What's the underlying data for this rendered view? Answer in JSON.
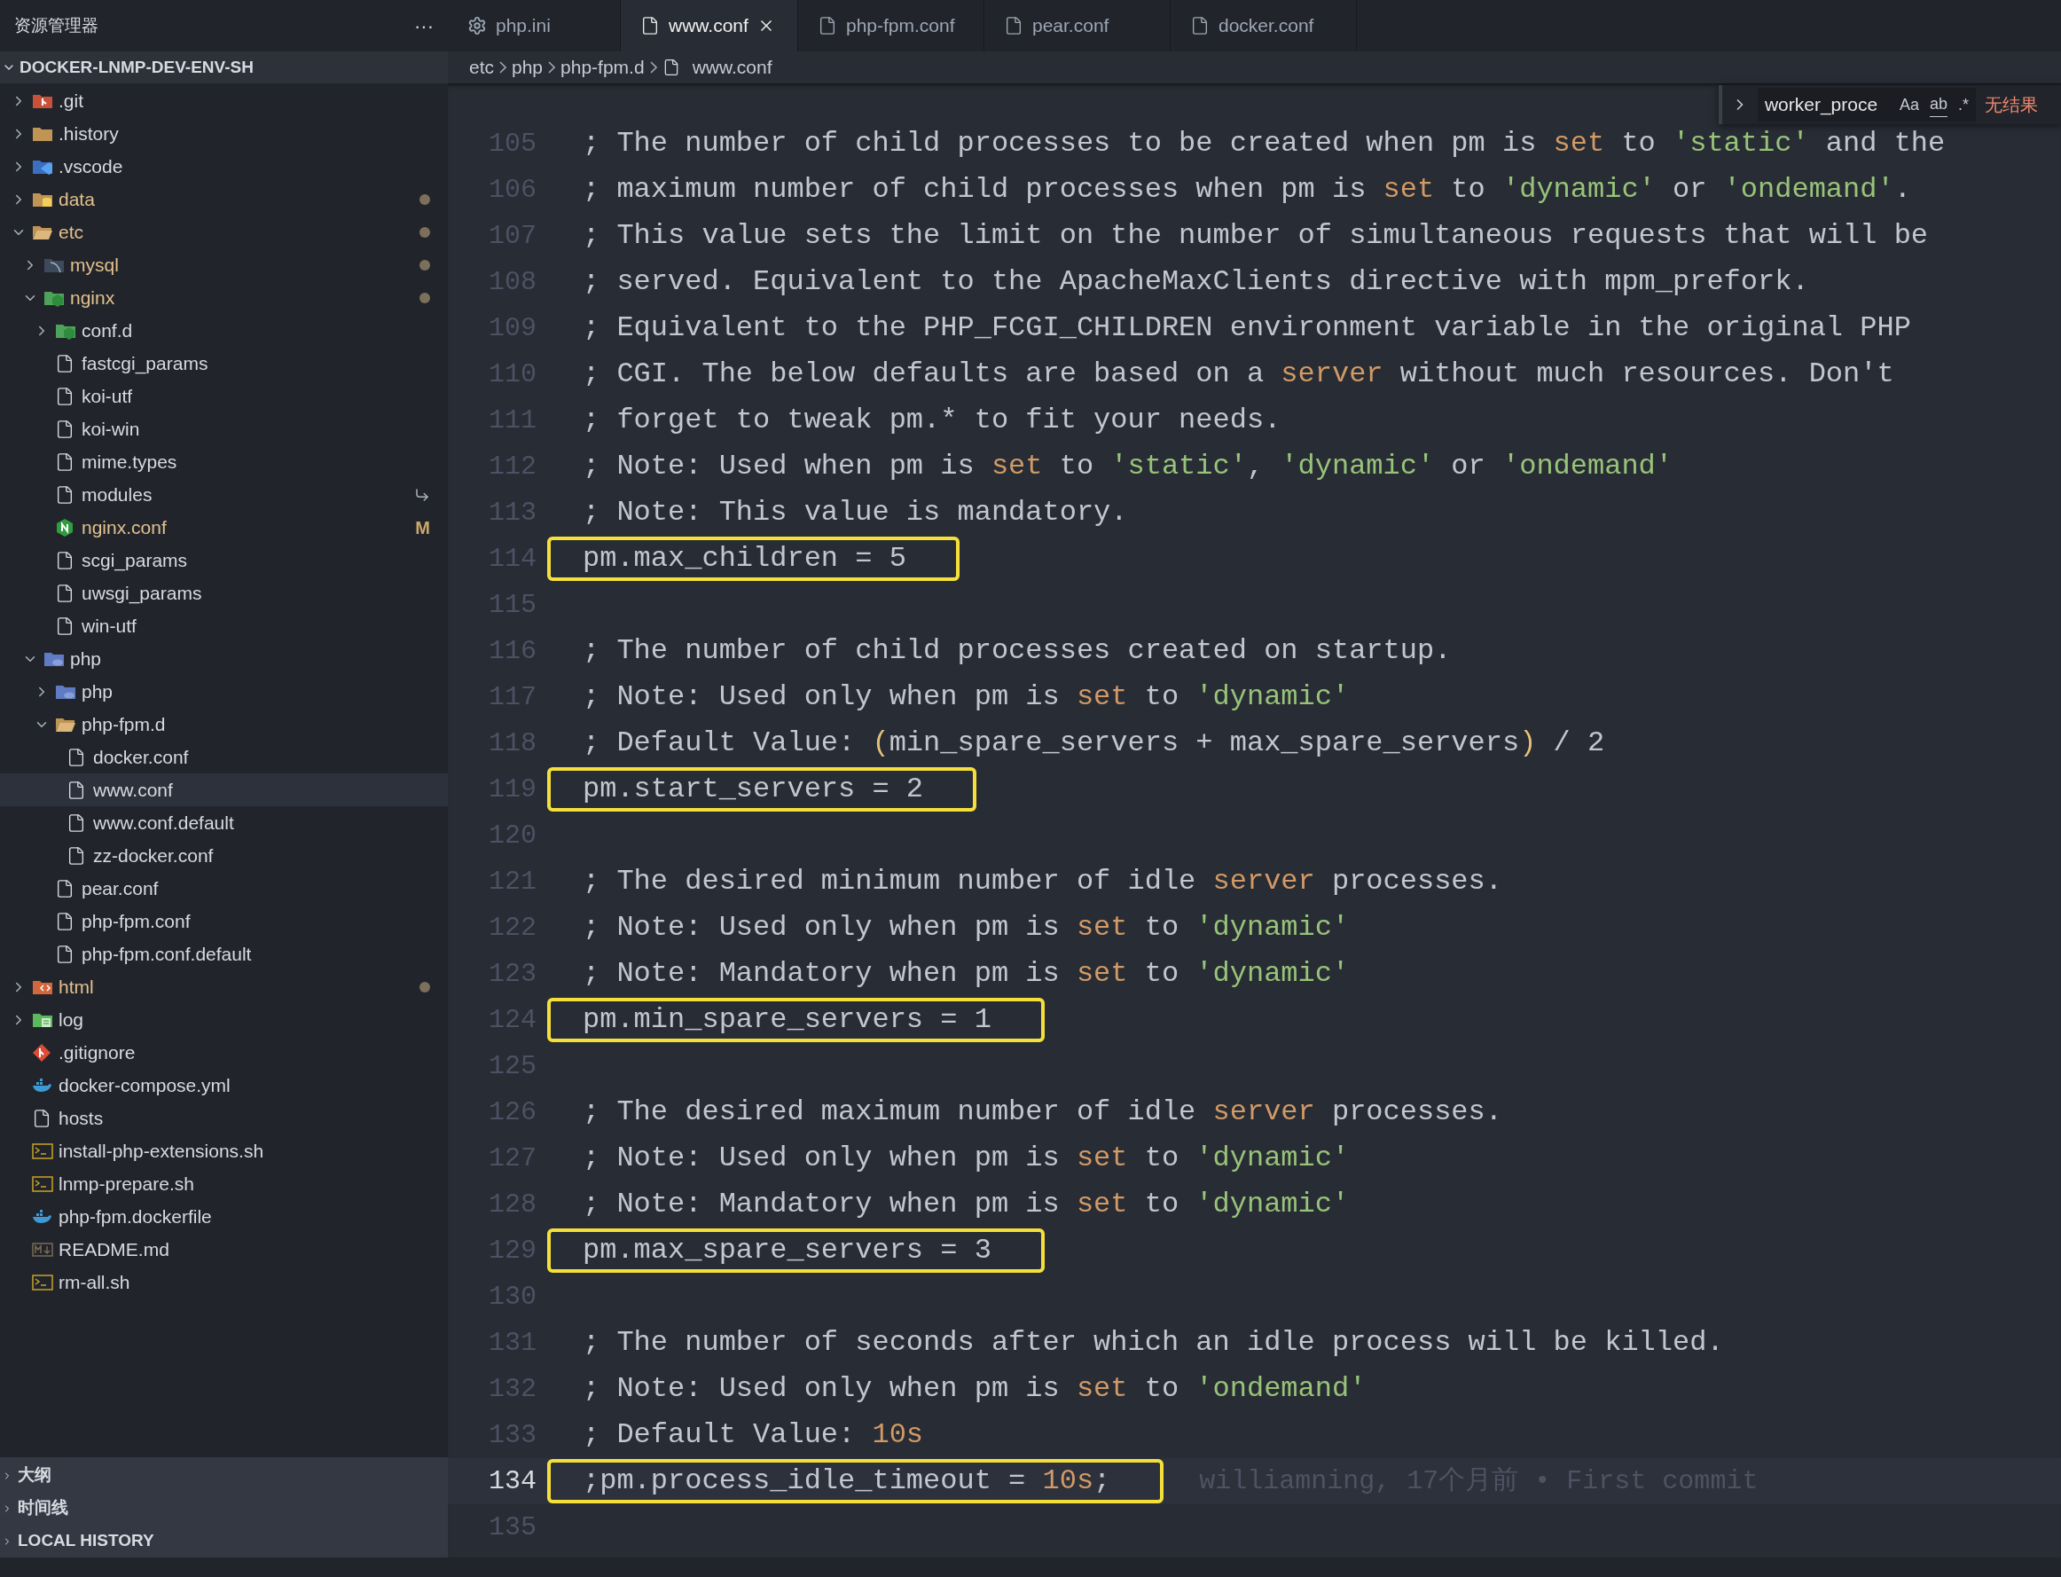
{
  "sidebar": {
    "title": "资源管理器",
    "more": "···",
    "root": {
      "name": "DOCKER-LNMP-DEV-ENV-SH",
      "expanded": true,
      "children": [
        {
          "name": ".git",
          "kind": "git-folder",
          "expanded": false,
          "modified": false,
          "selected": false
        },
        {
          "name": ".history",
          "kind": "folder",
          "expanded": false,
          "modified": false,
          "selected": false
        },
        {
          "name": ".vscode",
          "kind": "vscode-folder",
          "expanded": false,
          "modified": false,
          "selected": false
        },
        {
          "name": "data",
          "kind": "database-folder",
          "expanded": false,
          "modified": true,
          "selected": false
        },
        {
          "name": "etc",
          "kind": "folder",
          "expanded": true,
          "modified": true,
          "selected": false,
          "children": [
            {
              "name": "mysql",
              "kind": "mysql-folder",
              "expanded": false,
              "modified": true,
              "selected": false
            },
            {
              "name": "nginx",
              "kind": "nginx-folder",
              "expanded": true,
              "modified": true,
              "selected": false,
              "children": [
                {
                  "name": "conf.d",
                  "kind": "nginx-folder",
                  "expanded": false,
                  "modified": false,
                  "selected": false
                },
                {
                  "name": "fastcgi_params",
                  "kind": "file",
                  "modified": false,
                  "selected": false
                },
                {
                  "name": "koi-utf",
                  "kind": "file",
                  "modified": false,
                  "selected": false
                },
                {
                  "name": "koi-win",
                  "kind": "file",
                  "modified": false,
                  "selected": false
                },
                {
                  "name": "mime.types",
                  "kind": "file",
                  "modified": false,
                  "selected": false
                },
                {
                  "name": "modules",
                  "kind": "file",
                  "modified": false,
                  "selected": false,
                  "symlink": true
                },
                {
                  "name": "nginx.conf",
                  "kind": "nginx",
                  "modified": true,
                  "selected": false,
                  "badge": "M"
                },
                {
                  "name": "scgi_params",
                  "kind": "file",
                  "modified": false,
                  "selected": false
                },
                {
                  "name": "uwsgi_params",
                  "kind": "file",
                  "modified": false,
                  "selected": false
                },
                {
                  "name": "win-utf",
                  "kind": "file",
                  "modified": false,
                  "selected": false
                }
              ]
            },
            {
              "name": "php",
              "kind": "php-folder",
              "expanded": true,
              "modified": false,
              "selected": false,
              "children": [
                {
                  "name": "php",
                  "kind": "php-folder",
                  "expanded": false,
                  "modified": false,
                  "selected": false
                },
                {
                  "name": "php-fpm.d",
                  "kind": "folder",
                  "expanded": true,
                  "modified": false,
                  "selected": false,
                  "children": [
                    {
                      "name": "docker.conf",
                      "kind": "file",
                      "modified": false,
                      "selected": false
                    },
                    {
                      "name": "www.conf",
                      "kind": "file",
                      "modified": false,
                      "selected": true
                    },
                    {
                      "name": "www.conf.default",
                      "kind": "file",
                      "modified": false,
                      "selected": false
                    },
                    {
                      "name": "zz-docker.conf",
                      "kind": "file",
                      "modified": false,
                      "selected": false
                    }
                  ]
                },
                {
                  "name": "pear.conf",
                  "kind": "file",
                  "modified": false,
                  "selected": false
                },
                {
                  "name": "php-fpm.conf",
                  "kind": "file",
                  "modified": false,
                  "selected": false
                },
                {
                  "name": "php-fpm.conf.default",
                  "kind": "file",
                  "modified": false,
                  "selected": false
                }
              ]
            }
          ]
        },
        {
          "name": "html",
          "kind": "html-folder",
          "expanded": false,
          "modified": true,
          "selected": false
        },
        {
          "name": "log",
          "kind": "log-folder",
          "expanded": false,
          "modified": false,
          "selected": false
        },
        {
          "name": ".gitignore",
          "kind": "git",
          "modified": false,
          "selected": false
        },
        {
          "name": "docker-compose.yml",
          "kind": "docker",
          "modified": false,
          "selected": false
        },
        {
          "name": "hosts",
          "kind": "file",
          "modified": false,
          "selected": false
        },
        {
          "name": "install-php-extensions.sh",
          "kind": "shell",
          "modified": false,
          "selected": false
        },
        {
          "name": "lnmp-prepare.sh",
          "kind": "shell",
          "modified": false,
          "selected": false
        },
        {
          "name": "php-fpm.dockerfile",
          "kind": "docker",
          "modified": false,
          "selected": false
        },
        {
          "name": "README.md",
          "kind": "markdown",
          "modified": false,
          "selected": false
        },
        {
          "name": "rm-all.sh",
          "kind": "shell",
          "modified": false,
          "selected": false
        }
      ]
    },
    "panels": [
      {
        "label": "大纲",
        "expanded": false
      },
      {
        "label": "时间线",
        "expanded": false
      },
      {
        "label": "LOCAL HISTORY",
        "expanded": false
      }
    ]
  },
  "tabs": [
    {
      "label": "php.ini",
      "kind": "settings",
      "selected": false
    },
    {
      "label": "www.conf",
      "kind": "file",
      "selected": true
    },
    {
      "label": "php-fpm.conf",
      "kind": "file",
      "selected": false
    },
    {
      "label": "pear.conf",
      "kind": "file",
      "selected": false
    },
    {
      "label": "docker.conf",
      "kind": "file",
      "selected": false
    }
  ],
  "breadcrumb": [
    {
      "label": "etc",
      "kind": "folder"
    },
    {
      "label": "php",
      "kind": "folder"
    },
    {
      "label": "php-fpm.d",
      "kind": "folder"
    },
    {
      "label": "www.conf",
      "kind": "file"
    }
  ],
  "find_widget": {
    "value": "worker_proce",
    "options": [
      "Aa",
      "ab",
      ".*"
    ],
    "result": "无结果"
  },
  "editor": {
    "lines": [
      {
        "number": "105",
        "highlighted": false,
        "current": false,
        "segments": [
          {
            "kind": "comment",
            "text": "; The number of child processes to be created when pm is "
          },
          {
            "kind": "keyword",
            "text": "set"
          },
          {
            "kind": "comment",
            "text": " to "
          },
          {
            "kind": "string",
            "text": "'static'"
          },
          {
            "kind": "comment",
            "text": " and the"
          }
        ]
      },
      {
        "number": "106",
        "highlighted": false,
        "current": false,
        "segments": [
          {
            "kind": "comment",
            "text": "; maximum number of child processes when pm is "
          },
          {
            "kind": "keyword",
            "text": "set"
          },
          {
            "kind": "comment",
            "text": " to "
          },
          {
            "kind": "string",
            "text": "'dynamic'"
          },
          {
            "kind": "comment",
            "text": " or "
          },
          {
            "kind": "string",
            "text": "'ondemand'"
          },
          {
            "kind": "comment",
            "text": "."
          }
        ]
      },
      {
        "number": "107",
        "highlighted": false,
        "current": false,
        "segments": [
          {
            "kind": "comment",
            "text": "; This value sets the limit on the number of simultaneous requests that will be"
          }
        ]
      },
      {
        "number": "108",
        "highlighted": false,
        "current": false,
        "segments": [
          {
            "kind": "comment",
            "text": "; served. Equivalent to the ApacheMaxClients directive with mpm_prefork."
          }
        ]
      },
      {
        "number": "109",
        "highlighted": false,
        "current": false,
        "segments": [
          {
            "kind": "comment",
            "text": "; Equivalent to the PHP_FCGI_CHILDREN environment variable in the original PHP"
          }
        ]
      },
      {
        "number": "110",
        "highlighted": false,
        "current": false,
        "segments": [
          {
            "kind": "comment",
            "text": "; CGI. The below defaults are based on a "
          },
          {
            "kind": "keyword",
            "text": "server"
          },
          {
            "kind": "comment",
            "text": " without much resources. Don't"
          }
        ]
      },
      {
        "number": "111",
        "highlighted": false,
        "current": false,
        "segments": [
          {
            "kind": "comment",
            "text": "; forget to tweak pm.* to fit your needs."
          }
        ]
      },
      {
        "number": "112",
        "highlighted": false,
        "current": false,
        "segments": [
          {
            "kind": "comment",
            "text": "; Note: Used when pm is "
          },
          {
            "kind": "keyword",
            "text": "set"
          },
          {
            "kind": "comment",
            "text": " to "
          },
          {
            "kind": "string",
            "text": "'static'"
          },
          {
            "kind": "comment",
            "text": ", "
          },
          {
            "kind": "string",
            "text": "'dynamic'"
          },
          {
            "kind": "comment",
            "text": " or "
          },
          {
            "kind": "string",
            "text": "'ondemand'"
          }
        ]
      },
      {
        "number": "113",
        "highlighted": false,
        "current": false,
        "segments": [
          {
            "kind": "comment",
            "text": "; Note: This value is mandatory."
          }
        ]
      },
      {
        "number": "114",
        "highlighted": true,
        "current": false,
        "segments": [
          {
            "kind": "plain",
            "text": "pm.max_children = 5"
          }
        ]
      },
      {
        "number": "115",
        "highlighted": false,
        "current": false
      },
      {
        "number": "116",
        "highlighted": false,
        "current": false,
        "segments": [
          {
            "kind": "comment",
            "text": "; The number of child processes created on startup."
          }
        ]
      },
      {
        "number": "117",
        "highlighted": false,
        "current": false,
        "segments": [
          {
            "kind": "comment",
            "text": "; Note: Used only when pm is "
          },
          {
            "kind": "keyword",
            "text": "set"
          },
          {
            "kind": "comment",
            "text": " to "
          },
          {
            "kind": "string",
            "text": "'dynamic'"
          }
        ]
      },
      {
        "number": "118",
        "highlighted": false,
        "current": false,
        "segments": [
          {
            "kind": "comment",
            "text": "; Default Value: "
          },
          {
            "kind": "bracket",
            "text": "("
          },
          {
            "kind": "comment",
            "text": "min_spare_servers + max_spare_servers"
          },
          {
            "kind": "bracket",
            "text": ")"
          },
          {
            "kind": "comment",
            "text": " / 2"
          }
        ]
      },
      {
        "number": "119",
        "highlighted": true,
        "current": false,
        "segments": [
          {
            "kind": "plain",
            "text": "pm.start_servers = 2"
          }
        ]
      },
      {
        "number": "120",
        "highlighted": false,
        "current": false
      },
      {
        "number": "121",
        "highlighted": false,
        "current": false,
        "segments": [
          {
            "kind": "comment",
            "text": "; The desired minimum number of idle "
          },
          {
            "kind": "keyword",
            "text": "server"
          },
          {
            "kind": "comment",
            "text": " processes."
          }
        ]
      },
      {
        "number": "122",
        "highlighted": false,
        "current": false,
        "segments": [
          {
            "kind": "comment",
            "text": "; Note: Used only when pm is "
          },
          {
            "kind": "keyword",
            "text": "set"
          },
          {
            "kind": "comment",
            "text": " to "
          },
          {
            "kind": "string",
            "text": "'dynamic'"
          }
        ]
      },
      {
        "number": "123",
        "highlighted": false,
        "current": false,
        "segments": [
          {
            "kind": "comment",
            "text": "; Note: Mandatory when pm is "
          },
          {
            "kind": "keyword",
            "text": "set"
          },
          {
            "kind": "comment",
            "text": " to "
          },
          {
            "kind": "string",
            "text": "'dynamic'"
          }
        ]
      },
      {
        "number": "124",
        "highlighted": true,
        "current": false,
        "segments": [
          {
            "kind": "plain",
            "text": "pm.min_spare_servers = 1"
          }
        ]
      },
      {
        "number": "125",
        "highlighted": false,
        "current": false
      },
      {
        "number": "126",
        "highlighted": false,
        "current": false,
        "segments": [
          {
            "kind": "comment",
            "text": "; The desired maximum number of idle "
          },
          {
            "kind": "keyword",
            "text": "server"
          },
          {
            "kind": "comment",
            "text": " processes."
          }
        ]
      },
      {
        "number": "127",
        "highlighted": false,
        "current": false,
        "segments": [
          {
            "kind": "comment",
            "text": "; Note: Used only when pm is "
          },
          {
            "kind": "keyword",
            "text": "set"
          },
          {
            "kind": "comment",
            "text": " to "
          },
          {
            "kind": "string",
            "text": "'dynamic'"
          }
        ]
      },
      {
        "number": "128",
        "highlighted": false,
        "current": false,
        "segments": [
          {
            "kind": "comment",
            "text": "; Note: Mandatory when pm is "
          },
          {
            "kind": "keyword",
            "text": "set"
          },
          {
            "kind": "comment",
            "text": " to "
          },
          {
            "kind": "string",
            "text": "'dynamic'"
          }
        ]
      },
      {
        "number": "129",
        "highlighted": true,
        "current": false,
        "segments": [
          {
            "kind": "plain",
            "text": "pm.max_spare_servers = 3"
          }
        ]
      },
      {
        "number": "130",
        "highlighted": false,
        "current": false
      },
      {
        "number": "131",
        "highlighted": false,
        "current": false,
        "segments": [
          {
            "kind": "comment",
            "text": "; The number of seconds after which an idle process will be killed."
          }
        ]
      },
      {
        "number": "132",
        "highlighted": false,
        "current": false,
        "segments": [
          {
            "kind": "comment",
            "text": "; Note: Used only when pm is "
          },
          {
            "kind": "keyword",
            "text": "set"
          },
          {
            "kind": "comment",
            "text": " to "
          },
          {
            "kind": "string",
            "text": "'ondemand'"
          }
        ]
      },
      {
        "number": "133",
        "highlighted": false,
        "current": false,
        "segments": [
          {
            "kind": "comment",
            "text": "; Default Value: "
          },
          {
            "kind": "keyword",
            "text": "10s"
          }
        ]
      },
      {
        "number": "134",
        "highlighted": true,
        "current": true,
        "blame": "williamning, 17个月前 • First commit",
        "segments": [
          {
            "kind": "comment",
            "text": ";pm.process_idle_timeout = "
          },
          {
            "kind": "keyword",
            "text": "10s"
          },
          {
            "kind": "comment",
            "text": ";"
          }
        ]
      },
      {
        "number": "135",
        "highlighted": false,
        "current": false
      }
    ]
  }
}
